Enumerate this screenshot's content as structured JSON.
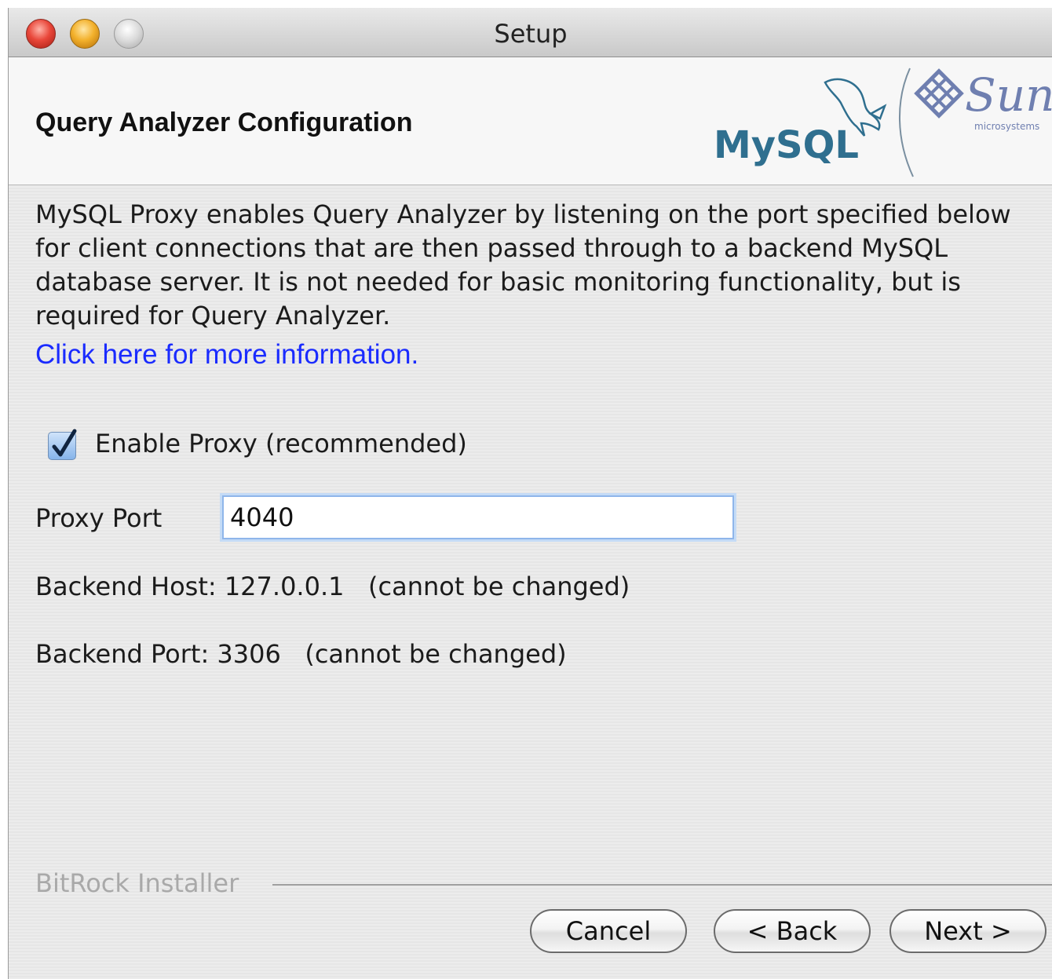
{
  "window": {
    "title": "Setup"
  },
  "header": {
    "title": "Query Analyzer Configuration",
    "logo_mysql": "MySQL",
    "logo_sun": "Sun",
    "logo_sun_sub": "microsystems"
  },
  "content": {
    "description": "MySQL Proxy enables Query Analyzer by listening on the port specified below for client connections that are then passed through to a backend MySQL database server. It is not needed for basic monitoring functionality, but is required for Query Analyzer.",
    "more_info_link": "Click here for more information.",
    "enable_proxy": {
      "label": "Enable Proxy (recommended)",
      "checked": true
    },
    "proxy_port": {
      "label": "Proxy Port",
      "value": "4040"
    },
    "backend_host_text": "Backend Host: 127.0.0.1   (cannot be changed)",
    "backend_port_text": "Backend Port: 3306   (cannot be changed)"
  },
  "footer": {
    "installer_label": "BitRock Installer",
    "buttons": {
      "cancel": "Cancel",
      "back": "< Back",
      "next": "Next >"
    }
  },
  "colors": {
    "link": "#1a2bff",
    "mysql_blue": "#2f6f8f",
    "mysql_orange": "#e58a1f",
    "sun_purple": "#6f7fb0"
  }
}
